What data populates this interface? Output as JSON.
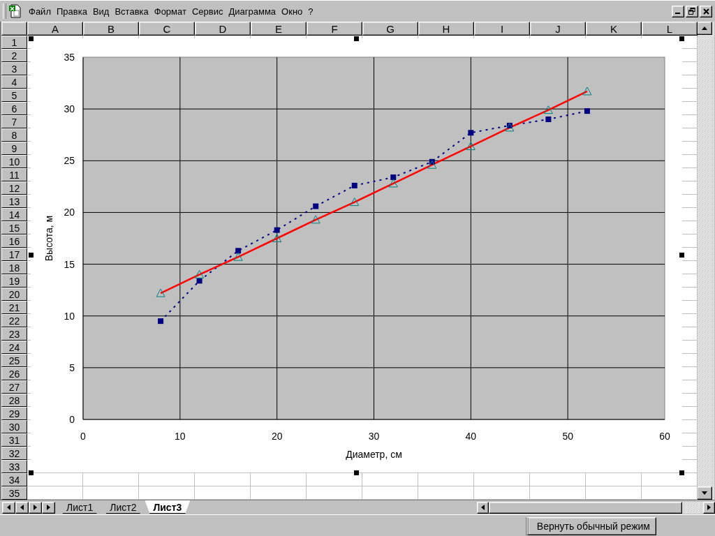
{
  "menu": [
    "Файл",
    "Правка",
    "Вид",
    "Вставка",
    "Формат",
    "Сервис",
    "Диаграмма",
    "Окно",
    "?"
  ],
  "columns": [
    "A",
    "B",
    "C",
    "D",
    "E",
    "F",
    "G",
    "H",
    "I",
    "J",
    "K",
    "L"
  ],
  "rows": [
    "1",
    "2",
    "3",
    "4",
    "5",
    "6",
    "7",
    "8",
    "9",
    "10",
    "11",
    "12",
    "13",
    "14",
    "15",
    "16",
    "17",
    "18",
    "19",
    "20",
    "21",
    "22",
    "23",
    "24",
    "25",
    "26",
    "27",
    "28",
    "29",
    "30",
    "31",
    "32",
    "33",
    "34",
    "35"
  ],
  "chart": {
    "chart_data": {
      "type": "line",
      "xlabel": "Диаметр, см",
      "ylabel": "Высота, м",
      "x": [
        8,
        12,
        16,
        20,
        24,
        28,
        32,
        36,
        40,
        44,
        48,
        52
      ],
      "xlim": [
        0,
        60
      ],
      "ylim": [
        0,
        35
      ],
      "xticks": [
        0,
        10,
        20,
        30,
        40,
        50,
        60
      ],
      "yticks": [
        0,
        5,
        10,
        15,
        20,
        25,
        30,
        35
      ],
      "grid": true,
      "series": [
        {
          "color": "#000080",
          "marker": "square",
          "line_style": "dashed",
          "values": [
            9.5,
            13.4,
            16.3,
            18.3,
            20.6,
            22.6,
            23.4,
            24.9,
            27.7,
            28.4,
            29.0,
            29.8
          ]
        },
        {
          "color": "#ff0000",
          "marker": "triangle",
          "line_style": "solid",
          "values": [
            12.2,
            14.0,
            15.7,
            17.5,
            19.3,
            21.0,
            22.8,
            24.6,
            26.4,
            28.2,
            29.9,
            31.7
          ]
        }
      ]
    }
  },
  "sheet_tabs": [
    {
      "label": "Лист1",
      "selected": false
    },
    {
      "label": "Лист2",
      "selected": false
    },
    {
      "label": "Лист3",
      "selected": true
    }
  ],
  "status_button": "Вернуть обычный режим"
}
